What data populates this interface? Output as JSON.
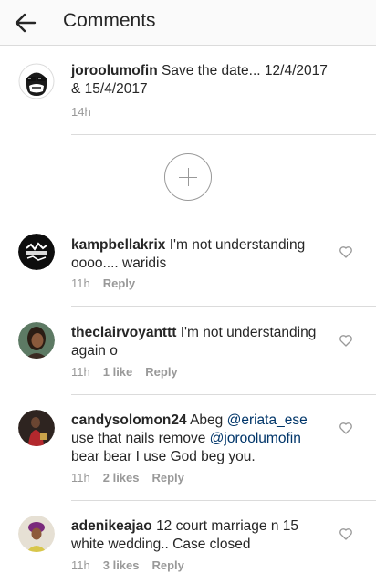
{
  "header": {
    "title": "Comments"
  },
  "caption": {
    "username": "joroolumofin",
    "text": "Save the date... 12/4/2017 & 15/4/2017",
    "time": "14h"
  },
  "comments": [
    {
      "username": "kampbellakrix",
      "text": "I'm not understanding oooo.... waridis",
      "time": "11h",
      "likes": "",
      "reply": "Reply"
    },
    {
      "username": "theclairvoyanttt",
      "text": "I'm not understanding again o",
      "time": "11h",
      "likes": "1 like",
      "reply": "Reply"
    },
    {
      "username": "candysolomon24",
      "text_before": "Abeg",
      "mention1": "@eriata_ese",
      "text_middle": "use that nails remove",
      "mention2": "@joroolumofin",
      "text_after": "bear bear I use God beg you.",
      "time": "11h",
      "likes": "2 likes",
      "reply": "Reply"
    },
    {
      "username": "adenikeajao",
      "text": "12 court marriage n 15 white wedding.. Case closed",
      "time": "11h",
      "likes": "3 likes",
      "reply": "Reply"
    }
  ]
}
